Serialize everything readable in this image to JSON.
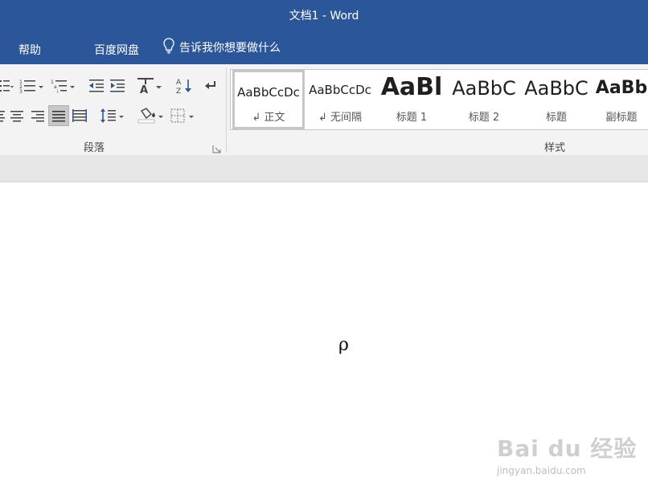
{
  "window": {
    "title": "文档1  -  Word",
    "accent": "#2b579a"
  },
  "menubar": {
    "help": "帮助",
    "baidu_pan": "百度网盘",
    "tell_me": "告诉我你想要做什么"
  },
  "ribbon": {
    "paragraph_group": "段落",
    "styles_group": "样式",
    "styles": [
      {
        "preview": "AaBbCcDc",
        "label": "↲ 正文",
        "active": true
      },
      {
        "preview": "AaBbCcDc",
        "label": "↲ 无间隔"
      },
      {
        "preview": "AaBl",
        "label": "标题 1"
      },
      {
        "preview": "AaBbC",
        "label": "标题 2"
      },
      {
        "preview": "AaBbC",
        "label": "标题"
      },
      {
        "preview": "AaBb",
        "label": "副标题"
      }
    ]
  },
  "document": {
    "content": "ρ"
  },
  "watermark": {
    "brand": "Bai du 经验",
    "url": "jingyan.baidu.com"
  }
}
